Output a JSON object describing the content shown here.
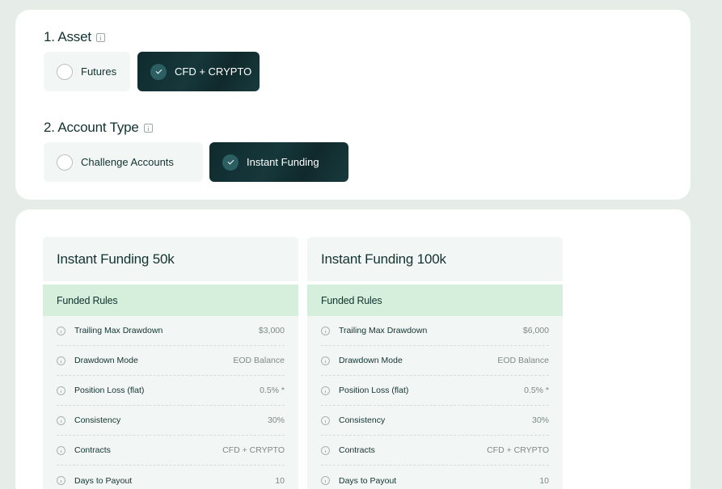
{
  "asset": {
    "title": "1. Asset",
    "options": [
      {
        "label": "Futures",
        "selected": false
      },
      {
        "label": "CFD + CRYPTO",
        "selected": true
      }
    ]
  },
  "account_type": {
    "title": "2. Account Type",
    "options": [
      {
        "label": "Challenge Accounts",
        "selected": false
      },
      {
        "label": "Instant Funding",
        "selected": true
      }
    ]
  },
  "plans": [
    {
      "name": "Instant Funding 50k",
      "rules_title": "Funded Rules",
      "rules": [
        {
          "label": "Trailing Max Drawdown",
          "value": "$3,000"
        },
        {
          "label": "Drawdown Mode",
          "value": "EOD Balance"
        },
        {
          "label": "Position Loss (flat)",
          "value": "0.5% *"
        },
        {
          "label": "Consistency",
          "value": "30%"
        },
        {
          "label": "Contracts",
          "value": "CFD + CRYPTO"
        },
        {
          "label": "Days to Payout",
          "value": "10"
        }
      ]
    },
    {
      "name": "Instant Funding 100k",
      "rules_title": "Funded Rules",
      "rules": [
        {
          "label": "Trailing Max Drawdown",
          "value": "$6,000"
        },
        {
          "label": "Drawdown Mode",
          "value": "EOD Balance"
        },
        {
          "label": "Position Loss (flat)",
          "value": "0.5% *"
        },
        {
          "label": "Consistency",
          "value": "30%"
        },
        {
          "label": "Contracts",
          "value": "CFD + CRYPTO"
        },
        {
          "label": "Days to Payout",
          "value": "10"
        }
      ]
    }
  ],
  "colors": {
    "background": "#e6ede9",
    "selected_option": "#0f2a2d",
    "rules_header": "#d6efdd",
    "text": "#12332f"
  }
}
